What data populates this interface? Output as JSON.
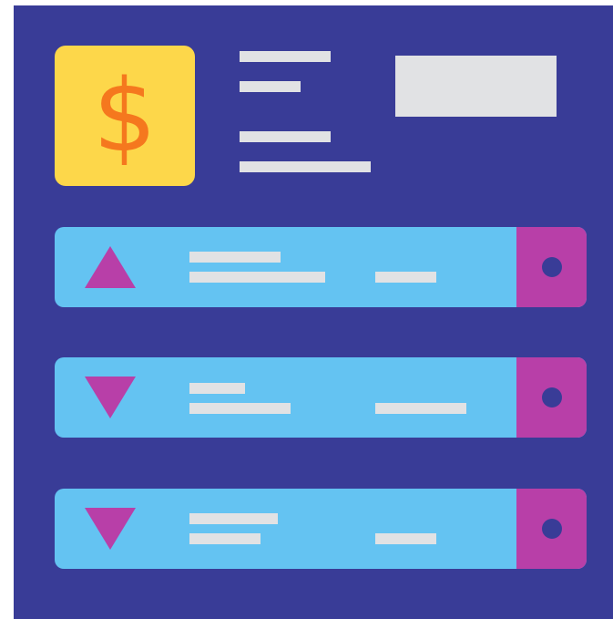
{
  "colors": {
    "panel": "#393c97",
    "coin_tile": "#fdd74a",
    "dollar": "#f5781e",
    "placeholder_bar": "#e1e2e4",
    "row": "#64c3f2",
    "row_tab": "#b83fa8",
    "row_dot": "#393c97",
    "trend_icon": "#b83fa8"
  },
  "icons": {
    "coin": "dollar-icon",
    "dollar_glyph": "$",
    "trend_up": "triangle-up-icon",
    "trend_down": "triangle-down-icon",
    "row_action": "dot-icon"
  },
  "rows": [
    {
      "trend": "up"
    },
    {
      "trend": "down"
    },
    {
      "trend": "down"
    }
  ]
}
